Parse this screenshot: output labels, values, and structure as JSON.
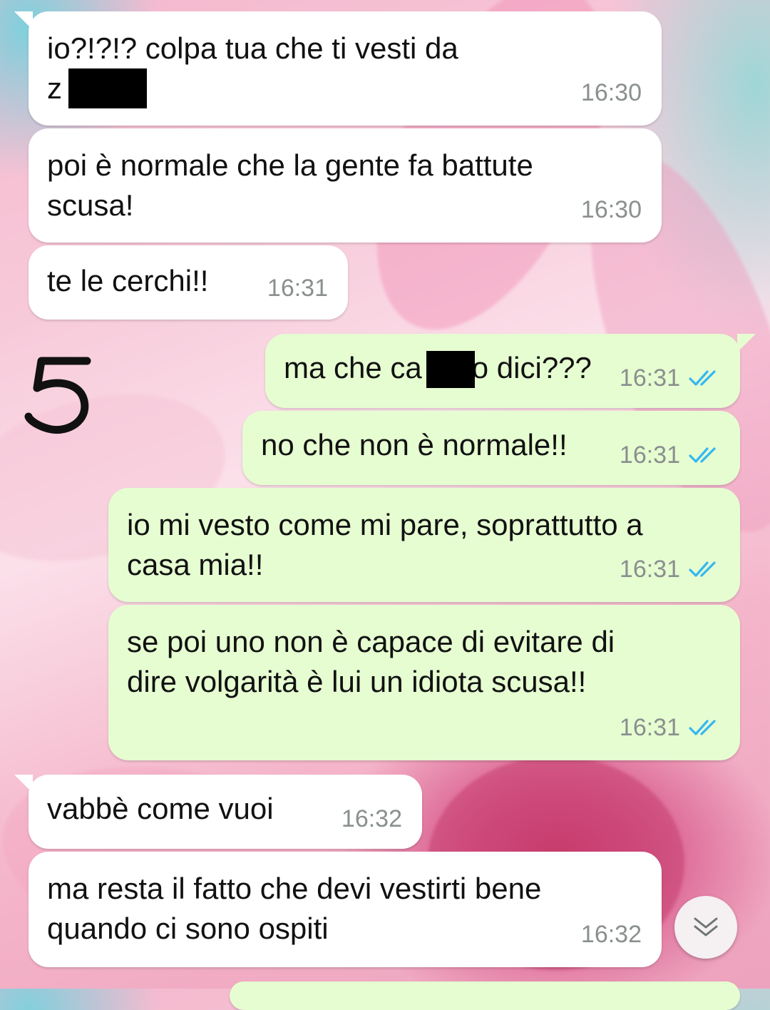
{
  "messages": [
    {
      "direction": "in",
      "text": "io?!?!? colpa tua che ti vesti da\nz      a!!",
      "time": "16:30"
    },
    {
      "direction": "in",
      "text": "poi è normale che la gente fa battute\nscusa!",
      "time": "16:30"
    },
    {
      "direction": "in",
      "text": "te le cerchi!!",
      "time": "16:31"
    },
    {
      "direction": "out",
      "text": "ma che ca      o dici???",
      "time": "16:31"
    },
    {
      "direction": "out",
      "text": "no che non è normale!!",
      "time": "16:31"
    },
    {
      "direction": "out",
      "text": "io mi vesto come mi pare, soprattutto a\ncasa mia!!",
      "time": "16:31"
    },
    {
      "direction": "out",
      "text": "se poi uno non è capace di evitare di\ndire volgarità è lui un idiota scusa!!",
      "time": "16:31"
    },
    {
      "direction": "in",
      "text": "vabbè come vuoi",
      "time": "16:32"
    },
    {
      "direction": "in",
      "text": "ma resta il fatto che devi vestirti bene\nquando ci sono ospiti",
      "time": "16:32"
    }
  ],
  "annotation": "5",
  "icons": {
    "read_receipt": "double-check-icon",
    "scroll_down": "double-chevron-down-icon"
  },
  "colors": {
    "incoming_bubble": "#ffffff",
    "outgoing_bubble": "#e6fdd1",
    "read_tick": "#34b7f1",
    "timestamp": "#8a8f8f"
  }
}
